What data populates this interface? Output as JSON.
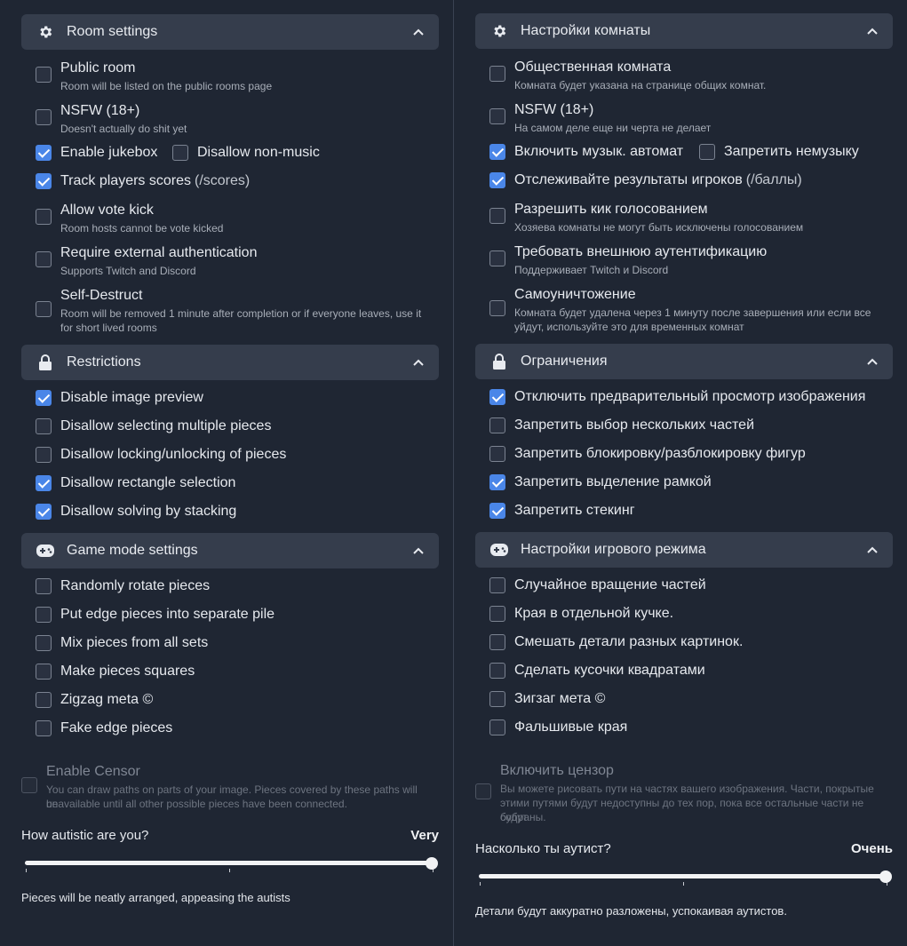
{
  "left": {
    "room_settings": {
      "title": "Room settings",
      "icon": "gear-icon",
      "options": {
        "public": {
          "label": "Public room",
          "desc": "Room will be listed on the public rooms page",
          "checked": false
        },
        "nsfw": {
          "label": "NSFW (18+)",
          "desc": "Doesn't actually do shit yet",
          "checked": false
        },
        "jukebox": {
          "label": "Enable jukebox",
          "checked": true
        },
        "nonmusic": {
          "label": "Disallow non-music",
          "checked": false
        },
        "scores": {
          "label": "Track players scores",
          "extra": "(/scores)",
          "checked": true
        },
        "votekick": {
          "label": "Allow vote kick",
          "desc": "Room hosts cannot be vote kicked",
          "checked": false
        },
        "auth": {
          "label": "Require external authentication",
          "desc": "Supports Twitch and Discord",
          "checked": false
        },
        "destruct": {
          "label": "Self-Destruct",
          "desc1": "Room will be removed 1 minute after completion or if everyone leaves, use it",
          "desc2": "for short lived rooms",
          "checked": false
        }
      }
    },
    "restrictions": {
      "title": "Restrictions",
      "icon": "lock-icon",
      "options": [
        {
          "label": "Disable image preview",
          "checked": true
        },
        {
          "label": "Disallow selecting multiple pieces",
          "checked": false
        },
        {
          "label": "Disallow locking/unlocking of pieces",
          "checked": false
        },
        {
          "label": "Disallow rectangle selection",
          "checked": true
        },
        {
          "label": "Disallow solving by stacking",
          "checked": true
        }
      ]
    },
    "game_mode": {
      "title": "Game mode settings",
      "icon": "gamepad-icon",
      "options": [
        {
          "label": "Randomly rotate pieces",
          "checked": false
        },
        {
          "label": "Put edge pieces into separate pile",
          "checked": false
        },
        {
          "label": "Mix pieces from all sets",
          "checked": false
        },
        {
          "label": "Make pieces squares",
          "checked": false
        },
        {
          "label": "Zigzag meta ©",
          "checked": false
        },
        {
          "label": "Fake edge pieces",
          "checked": false
        }
      ]
    },
    "censor": {
      "label": "Enable Censor",
      "desc1": "You can draw paths on parts of your image. Pieces covered by these paths will be",
      "desc2": "unavailable until all other possible pieces have been connected."
    },
    "slider": {
      "label": "How autistic are you?",
      "value": "Very",
      "level": 1.0,
      "note": "Pieces will be neatly arranged, appeasing the autists"
    }
  },
  "right": {
    "room_settings": {
      "title": "Настройки комнаты",
      "options": {
        "public": {
          "label": "Общественная комната",
          "desc": "Комната будет указана на странице общих комнат.",
          "checked": false
        },
        "nsfw": {
          "label": "NSFW (18+)",
          "desc": "На самом деле еще ни черта не делает",
          "checked": false
        },
        "jukebox": {
          "label": "Включить музык. автомат",
          "checked": true
        },
        "nonmusic": {
          "label": "Запретить немузыку",
          "checked": false
        },
        "scores": {
          "label": "Отслеживайте результаты игроков",
          "extra": "(/баллы)",
          "checked": true
        },
        "votekick": {
          "label": "Разрешить кик голосованием",
          "desc": "Хозяева комнаты не могут быть исключены голосованием",
          "checked": false
        },
        "auth": {
          "label": "Требовать внешнюю аутентификацию",
          "desc": "Поддерживает Twitch и Discord",
          "checked": false
        },
        "destruct": {
          "label": "Самоуничтожение",
          "desc1": "Комната будет удалена через 1 минуту после завершения или если все",
          "desc2": "уйдут, используйте это для временных комнат",
          "checked": false
        }
      }
    },
    "restrictions": {
      "title": "Ограничения",
      "options": [
        {
          "label": "Отключить предварительный просмотр изображения",
          "checked": true
        },
        {
          "label": "Запретить выбор нескольких частей",
          "checked": false
        },
        {
          "label": "Запретить блокировку/разблокировку фигур",
          "checked": false
        },
        {
          "label": "Запретить выделение рамкой",
          "checked": true
        },
        {
          "label": "Запретить стекинг",
          "checked": true
        }
      ]
    },
    "game_mode": {
      "title": "Настройки игрового режима",
      "options": [
        {
          "label": "Случайное вращение частей",
          "checked": false
        },
        {
          "label": "Края в отдельной кучке.",
          "checked": false
        },
        {
          "label": "Смешать детали разных картинок.",
          "checked": false
        },
        {
          "label": "Сделать кусочки квадратами",
          "checked": false
        },
        {
          "label": "Зигзаг мета ©",
          "checked": false
        },
        {
          "label": "Фальшивые края",
          "checked": false
        }
      ]
    },
    "censor": {
      "label": "Включить цензор",
      "desc1": "Вы можете рисовать пути на частях вашего изображения. Части, покрытые",
      "desc2": "этими путями будут недоступны до тех пор, пока все остальные части не будут",
      "desc3": "собраны."
    },
    "slider": {
      "label": "Насколько ты аутист?",
      "value": "Очень",
      "level": 1.0,
      "note": "Детали будут аккуратно разложены, успокаивая аутистов."
    }
  },
  "colors": {
    "background": "#1f2633",
    "header": "#353d4c",
    "checkbox_checked": "#4a86e8"
  }
}
